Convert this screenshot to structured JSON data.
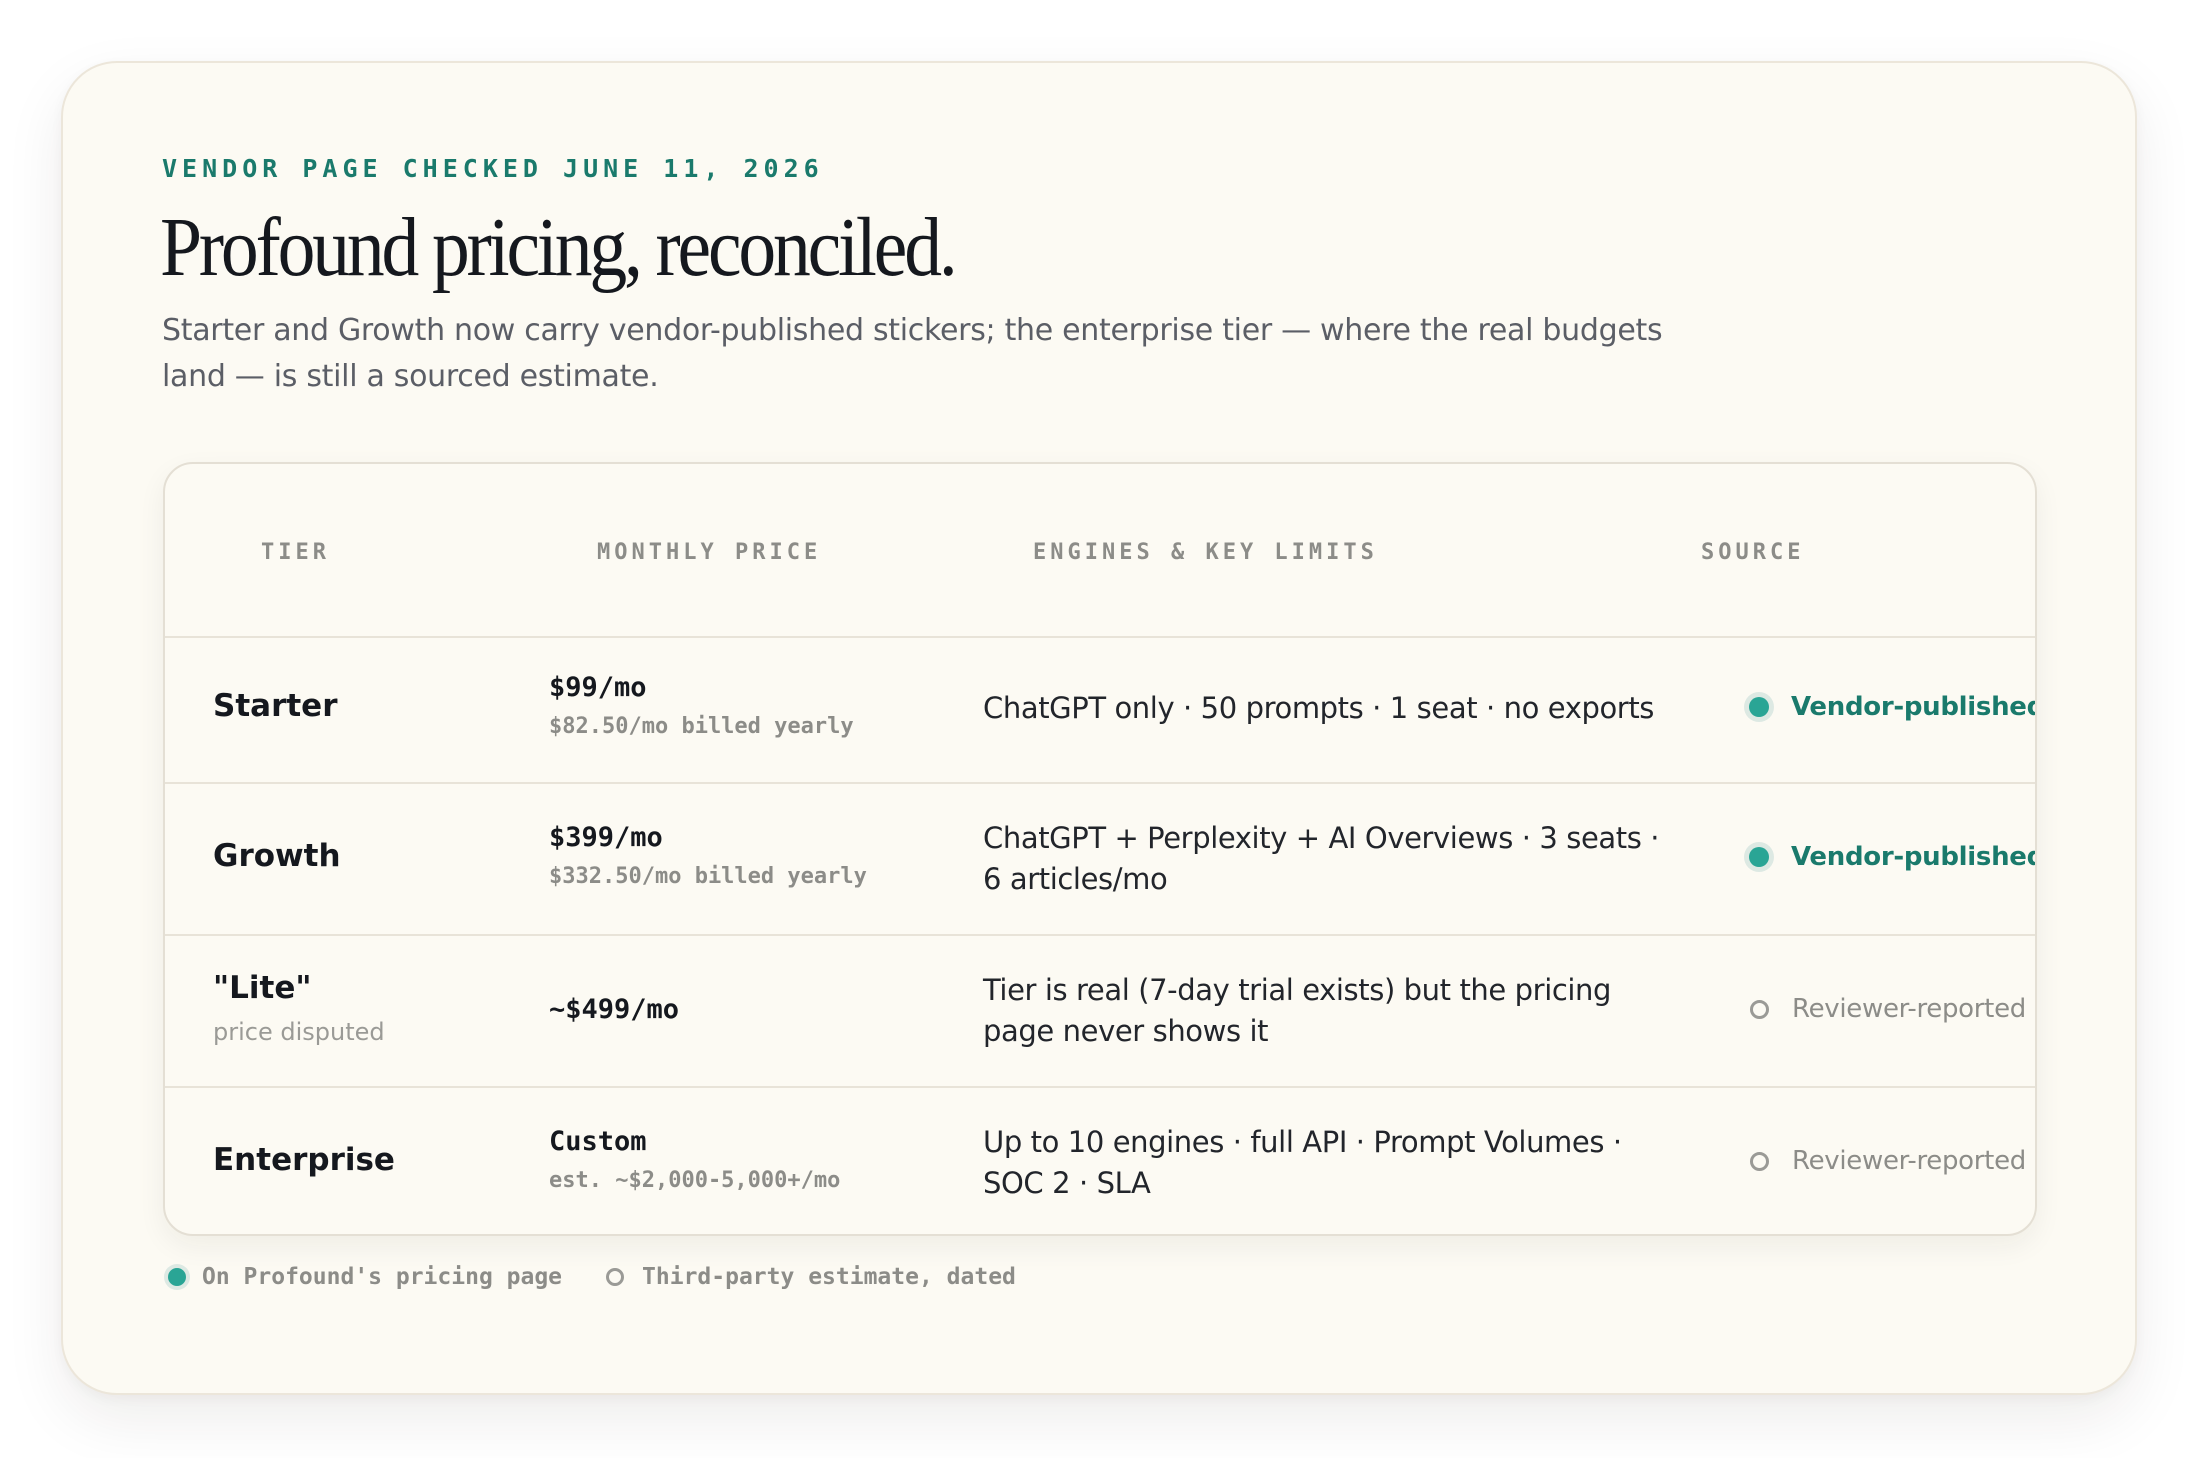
{
  "header": {
    "eyebrow": "VENDOR PAGE CHECKED JUNE 11, 2026",
    "title": "Profound pricing, reconciled.",
    "subtitle": "Starter and Growth now carry vendor-published stickers; the enterprise tier — where the real budgets land — is still a sourced estimate."
  },
  "table": {
    "columns": [
      "TIER",
      "MONTHLY PRICE",
      "ENGINES & KEY LIMITS",
      "SOURCE"
    ],
    "rows": [
      {
        "tier": "Starter",
        "tier_note": "",
        "price": "$99/mo",
        "price_sub": "$82.50/mo billed yearly",
        "limits": "ChatGPT only · 50 prompts · 1 seat · no exports",
        "source": "Vendor-published",
        "source_type": "vendor"
      },
      {
        "tier": "Growth",
        "tier_note": "",
        "price": "$399/mo",
        "price_sub": "$332.50/mo billed yearly",
        "limits": "ChatGPT + Perplexity + AI Overviews · 3 seats · 6 articles/mo",
        "source": "Vendor-published",
        "source_type": "vendor"
      },
      {
        "tier": "\"Lite\"",
        "tier_note": "price disputed",
        "price": "~$499/mo",
        "price_sub": "",
        "limits": "Tier is real (7-day trial exists) but the pricing page never shows it",
        "source": "Reviewer-reported",
        "source_type": "reviewer"
      },
      {
        "tier": "Enterprise",
        "tier_note": "",
        "price": "Custom",
        "price_sub": "est. ~$2,000-5,000+/mo",
        "limits": "Up to 10 engines · full API · Prompt Volumes · SOC 2 · SLA",
        "source": "Reviewer-reported",
        "source_type": "reviewer"
      }
    ]
  },
  "legend": {
    "vendor_label": "On Profound's pricing page",
    "reviewer_label": "Third-party estimate, dated"
  },
  "colors": {
    "accent": "#1a7a6c",
    "dot": "#2aa595",
    "muted": "#8c8c88",
    "card_bg": "#fcfaf3",
    "text": "#15181e"
  },
  "icons": {
    "vendor_marker": "filled-dot-icon",
    "reviewer_marker": "hollow-circle-icon"
  }
}
